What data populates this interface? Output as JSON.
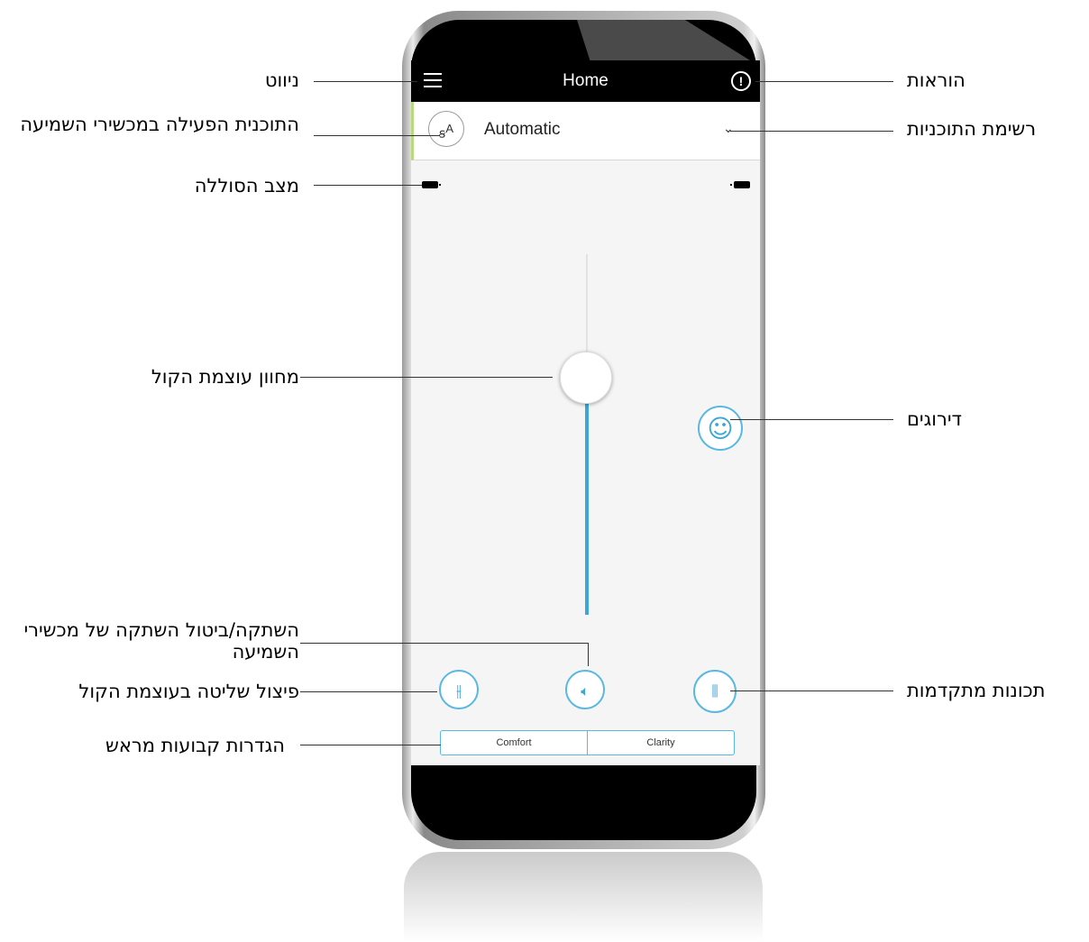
{
  "app": {
    "title": "Home",
    "program": {
      "icon_text": "A",
      "name": "Automatic"
    },
    "presets": [
      "Comfort",
      "Clarity"
    ],
    "accent_color": "#3aa7d8",
    "icons": {
      "menu": "hamburger-menu-icon",
      "info": "info-icon",
      "program": "hearing-program-icon",
      "chevron": "chevron-down-icon",
      "battery": "battery-icon",
      "rating": "smiley-icon",
      "split": "split-sliders-icon",
      "mute": "speaker-icon",
      "advanced": "equalizer-icon"
    }
  },
  "annotations": {
    "navigation": "ניווט",
    "active_program": "התוכנית הפעילה במכשירי השמיעה",
    "battery_status": "מצב הסוללה",
    "volume_indicator": "מחוון עוצמת הקול",
    "mute": "השתקה/ביטול השתקה של מכשירי השמיעה",
    "volume_split": "פיצול שליטה בעוצמת הקול",
    "presets": "הגדרות קבועות מראש",
    "instructions": "הוראות",
    "program_list": "רשימת התוכניות",
    "ratings": "דירוגים",
    "advanced": "תכונות מתקדמות"
  }
}
